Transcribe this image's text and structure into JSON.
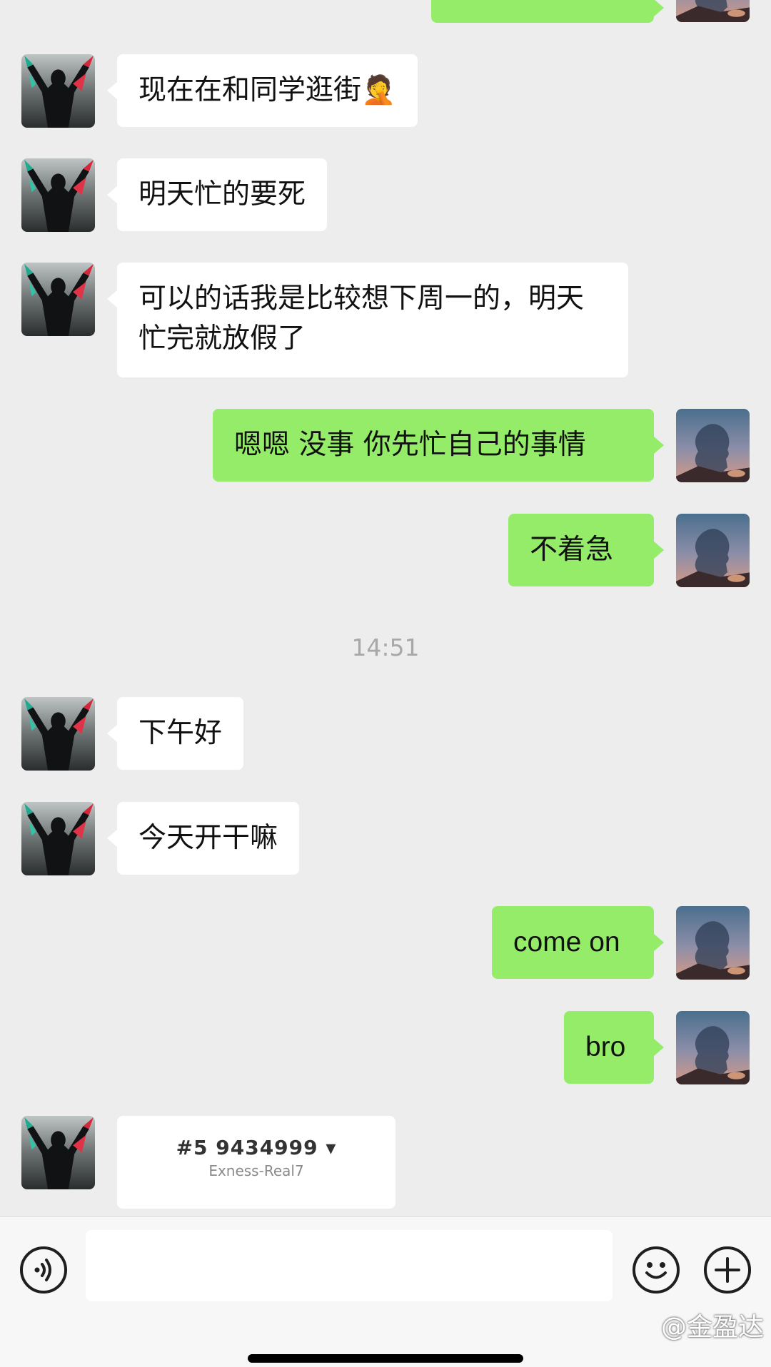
{
  "messages": {
    "m0": "",
    "m1": "现在在和同学逛街🤦",
    "m2": "明天忙的要死",
    "m3": "可以的话我是比较想下周一的，明天忙完就放假了",
    "m4": "嗯嗯 没事 你先忙自己的事情",
    "m5": "不着急",
    "time": "14:51",
    "m6": "下午好",
    "m7": "今天开干嘛",
    "m8": "come on",
    "m9": "bro"
  },
  "card": {
    "account": "#5   9434999 ▾",
    "server": "Exness-Real7"
  },
  "input": {
    "voice_icon": "voice-icon",
    "emoji_icon": "emoji-icon",
    "plus_icon": "plus-icon"
  },
  "watermark": "@金盈达",
  "colors": {
    "background": "#ededed",
    "outgoing_bubble": "#95ec69",
    "incoming_bubble": "#ffffff"
  }
}
